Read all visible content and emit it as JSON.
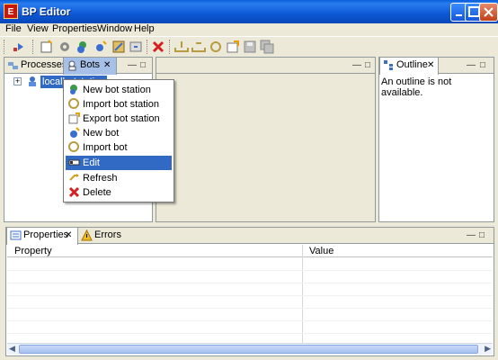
{
  "window": {
    "title": "BP Editor",
    "app_icon_letter": "E"
  },
  "menubar": {
    "items": [
      "File",
      "View",
      "Properties",
      "Window",
      "Help"
    ]
  },
  "toolbar": {
    "icons": [
      "run-icon",
      "new-process-icon",
      "process-settings-icon",
      "new-bot-station-icon",
      "new-bot-icon",
      "edit-icon",
      "refresh-icon",
      "delete-icon",
      "tray-in-icon",
      "tray-out-icon",
      "undo-icon",
      "export-icon",
      "save-icon",
      "save-all-icon"
    ]
  },
  "left_panel": {
    "tabs": [
      {
        "label": "Processes"
      },
      {
        "label": "Bots"
      }
    ],
    "close_glyph": "✕",
    "tree": {
      "expand_glyph": "+",
      "node_label": "localbotstation"
    }
  },
  "context_menu": {
    "items": [
      {
        "label": "New bot station",
        "icon": "bot-station-icon"
      },
      {
        "label": "Import bot station",
        "icon": "import-icon"
      },
      {
        "label": "Export bot station",
        "icon": "export-icon"
      },
      {
        "label": "New bot",
        "icon": "new-bot-icon"
      },
      {
        "label": "Import bot",
        "icon": "import-bot-icon"
      },
      {
        "label": "Edit",
        "icon": "edit-icon",
        "selected": true
      },
      {
        "label": "Refresh",
        "icon": "refresh-icon"
      },
      {
        "label": "Delete",
        "icon": "delete-icon"
      }
    ]
  },
  "outline_panel": {
    "tab_label": "Outline",
    "message": "An outline is not available."
  },
  "bottom_panel": {
    "tabs": [
      {
        "label": "Properties"
      },
      {
        "label": "Errors"
      }
    ],
    "columns": [
      "Property",
      "Value"
    ]
  },
  "colors": {
    "selection": "#316ac5",
    "title_bar": "#0d58d6",
    "chrome": "#ece9d8",
    "border": "#919b9c"
  }
}
